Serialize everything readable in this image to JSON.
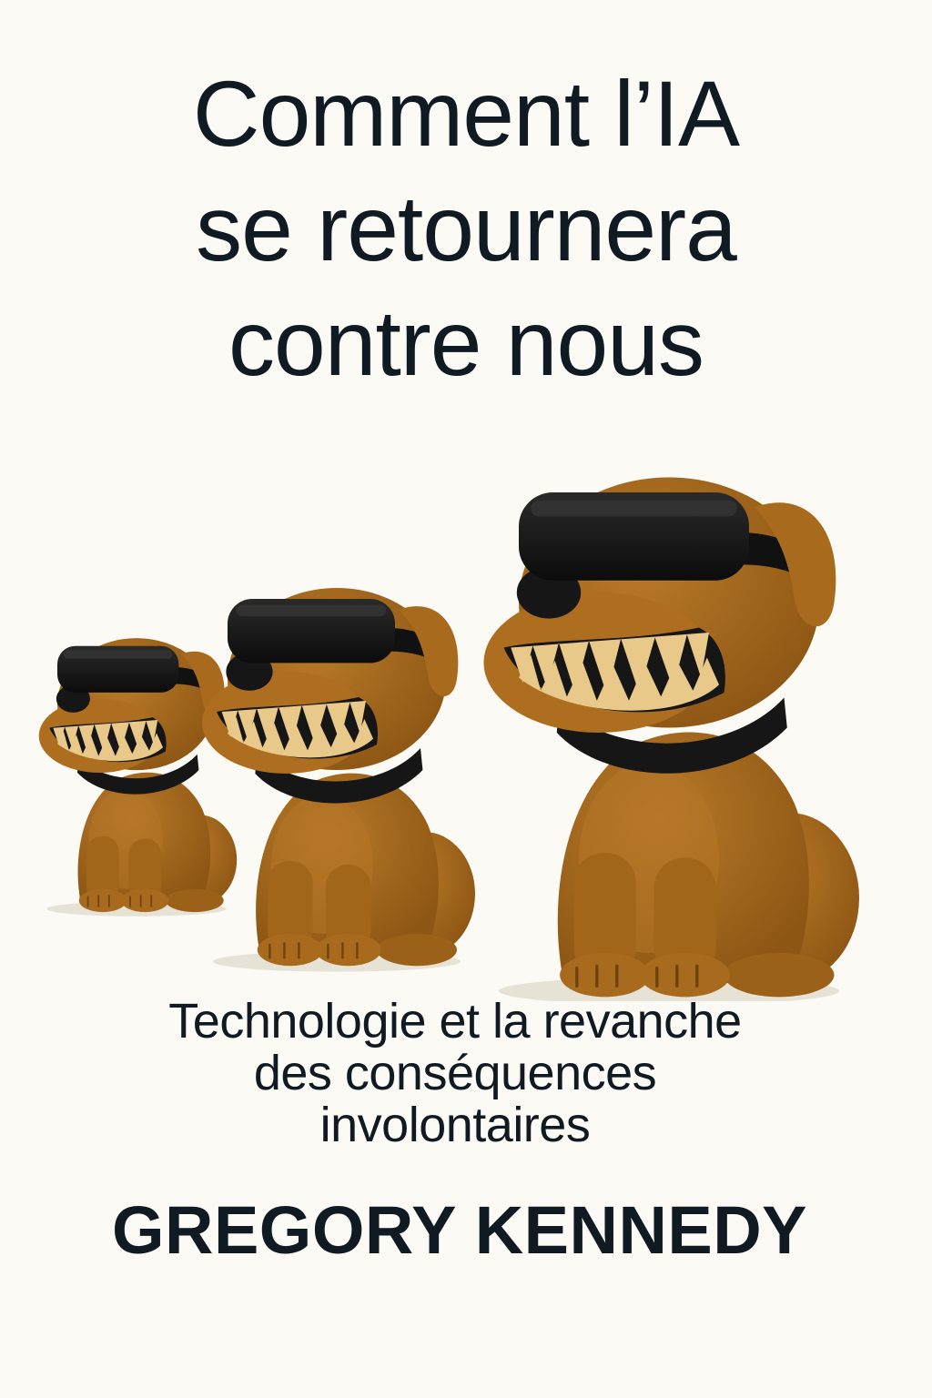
{
  "cover": {
    "title_lines": [
      "Comment l’IA",
      "se retournera",
      "contre nous"
    ],
    "subtitle_lines": [
      "Technologie et la revanche",
      "des conséquences",
      "involontaires"
    ],
    "author": "GREGORY KENNEDY"
  },
  "colors": {
    "background": "#fbfaf4",
    "text": "#0f1a22",
    "dog_fur": "#a86a1c",
    "dog_fur_shadow": "#8a5412",
    "goggles": "#161616",
    "teeth": "#e9c98a"
  },
  "illustration": {
    "subject": "three-snarling-dogs-wearing-vr-goggles",
    "count": 3
  }
}
